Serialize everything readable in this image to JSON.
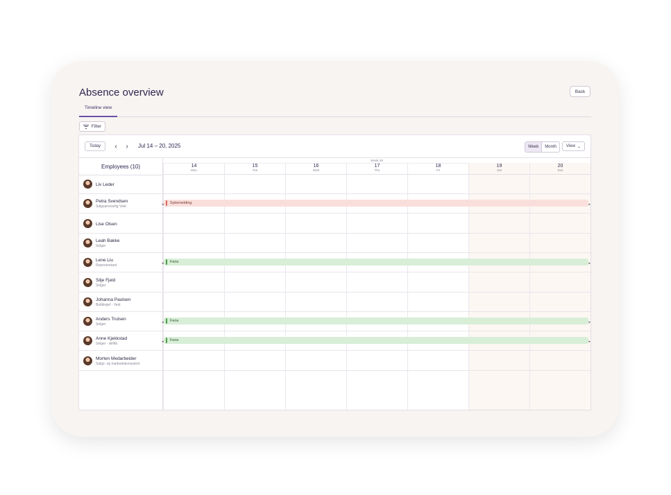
{
  "page": {
    "title": "Absence overview",
    "back_label": "Back",
    "tab_label": "Timeline view",
    "filter_label": "Filter"
  },
  "toolbar": {
    "today_label": "Today",
    "prev_icon": "chevron-left-icon",
    "next_icon": "chevron-right-icon",
    "date_range": "Jul 14 – 20, 2025",
    "week_label": "Week",
    "month_label": "Month",
    "view_label": "View"
  },
  "grid": {
    "employees_header": "Employees (10)",
    "week_label": "Week 29",
    "days": [
      {
        "num": "14",
        "name": "Mon"
      },
      {
        "num": "15",
        "name": "Tue"
      },
      {
        "num": "16",
        "name": "Wed"
      },
      {
        "num": "17",
        "name": "Thu"
      },
      {
        "num": "18",
        "name": "Fri"
      },
      {
        "num": "19",
        "name": "Sat"
      },
      {
        "num": "20",
        "name": "Sun"
      }
    ]
  },
  "employees": [
    {
      "name": "Liv Leder",
      "role": ""
    },
    {
      "name": "Petra Svendsen",
      "role": "Salgsansvarlig Vest",
      "absence": "Sykemelding"
    },
    {
      "name": "Lise Olsen",
      "role": ""
    },
    {
      "name": "Leah Bakke",
      "role": "Selger"
    },
    {
      "name": "Lene Liu",
      "role": "Representant",
      "absence": "Ferie"
    },
    {
      "name": "Silje Fjeld",
      "role": "Selger"
    },
    {
      "name": "Johanna Paulsen",
      "role": "Butikksjef - Vest"
    },
    {
      "name": "Anders Trulsen",
      "role": "Selger",
      "absence": "Ferie"
    },
    {
      "name": "Anne Kjekkstad",
      "role": "Selger - deltid",
      "absence": "Ferie"
    },
    {
      "name": "Morten Medarbeider",
      "role": "Salgs- og markedskonsulent"
    }
  ]
}
